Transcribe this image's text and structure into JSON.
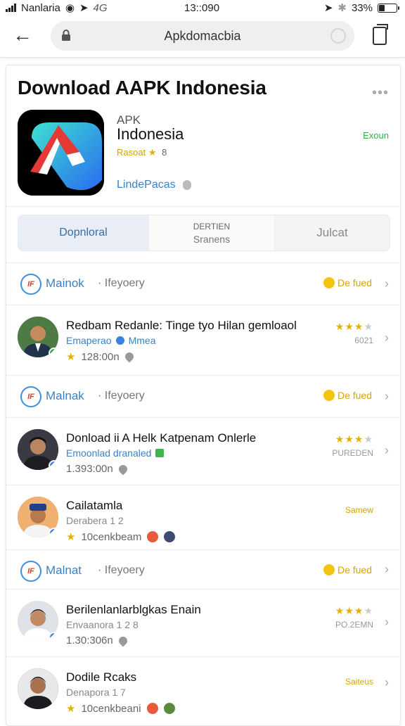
{
  "status_bar": {
    "carrier": "Nanlaria",
    "extra": "4G",
    "time": "13::090",
    "battery": "33%",
    "battery_level": 0.33
  },
  "browser": {
    "url": "Apkdomacbia"
  },
  "page": {
    "title": "Download AAPK Indonesia",
    "more": "•••",
    "app": {
      "line1": "APK",
      "line2": "Indonesia",
      "rating_text": "Rasoat",
      "rating_stars": "★",
      "rating_num": "8",
      "developer": "LindePacas",
      "action": "Exoun"
    },
    "segments": [
      {
        "label": "Dopnloral"
      },
      {
        "label_top": "DERTIEN",
        "label_bottom": "Sranens"
      },
      {
        "label": "Julcat"
      }
    ]
  },
  "list": [
    {
      "kind": "header",
      "logo": "IF",
      "name": "Mainok",
      "category": "· Ifeyoery",
      "badge": "De fued"
    },
    {
      "kind": "item",
      "title": "Redbam Redanle: Tinge tyo Hilan gemloaol",
      "sub": "Emaperao",
      "sub2": "Mmea",
      "meta": "128:00n",
      "stars": "★★★",
      "stars_off": "★",
      "count": "6021",
      "avatar_bg": "#3d6a3a",
      "check": "#2fa84a"
    },
    {
      "kind": "header",
      "logo": "IF",
      "name": "Malnak",
      "category": "· Ifeyoery",
      "badge": "De fued"
    },
    {
      "kind": "item",
      "title": "Donload ii A Helk Katpenam Onlerle",
      "sub": "Emoonlad dranaled",
      "meta": "1.393:00n",
      "stars": "★★★",
      "stars_off": "★",
      "count": "PUREDEN",
      "avatar_bg": "#2c2c36",
      "check": "#3a82e0"
    },
    {
      "kind": "item",
      "title": "Cailatamla",
      "sub": "Derabera 1 2",
      "meta": "10cenkbeam",
      "word": "Samew",
      "avatar_bg": "#e3a060",
      "check": "#3a82e0"
    },
    {
      "kind": "header",
      "logo": "IF",
      "name": "Malnat",
      "category": "· Ifeyoery",
      "badge": "De fued"
    },
    {
      "kind": "item",
      "title": "Berilenlanlarblgkas Enain",
      "sub": "Envaanora 1 2 8",
      "meta": "1.30:306n",
      "stars": "★★★",
      "stars_off": "★",
      "count": "PO.2EMN",
      "avatar_bg": "#cfd5dd",
      "check": "#3a82e0"
    },
    {
      "kind": "item",
      "title": "Dodile Rcaks",
      "sub": "Denapora 1 7",
      "meta": "10cenkbeani",
      "word": "Saiteus",
      "avatar_bg": "#3b3b44",
      "check": "#3a82e0"
    }
  ]
}
